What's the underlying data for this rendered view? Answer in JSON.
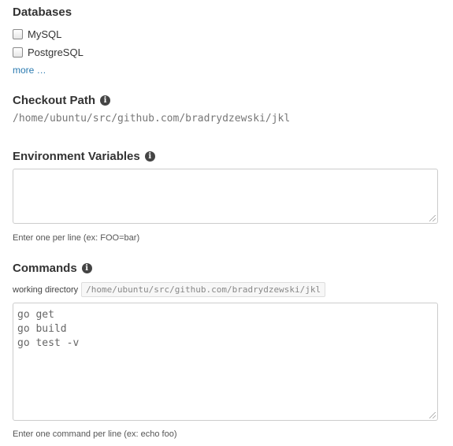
{
  "databases": {
    "title": "Databases",
    "options": [
      {
        "label": "MySQL",
        "checked": false
      },
      {
        "label": "PostgreSQL",
        "checked": false
      }
    ],
    "more_link": "more …"
  },
  "checkout_path": {
    "title": "Checkout Path",
    "info_icon": "info-icon",
    "value": "/home/ubuntu/src/github.com/bradrydzewski/jkl"
  },
  "environment_variables": {
    "title": "Environment Variables",
    "info_icon": "info-icon",
    "value": "",
    "help": "Enter one per line (ex: FOO=bar)"
  },
  "commands": {
    "title": "Commands",
    "info_icon": "info-icon",
    "working_directory_label": "working directory",
    "working_directory_value": "/home/ubuntu/src/github.com/bradrydzewski/jkl",
    "lines": [
      "go get",
      "go build",
      "go test -v"
    ],
    "help": "Enter one command per line (ex: echo foo)"
  },
  "colors": {
    "link": "#2a7ab0",
    "text": "#333333",
    "muted": "#777777",
    "border": "#cccccc"
  }
}
